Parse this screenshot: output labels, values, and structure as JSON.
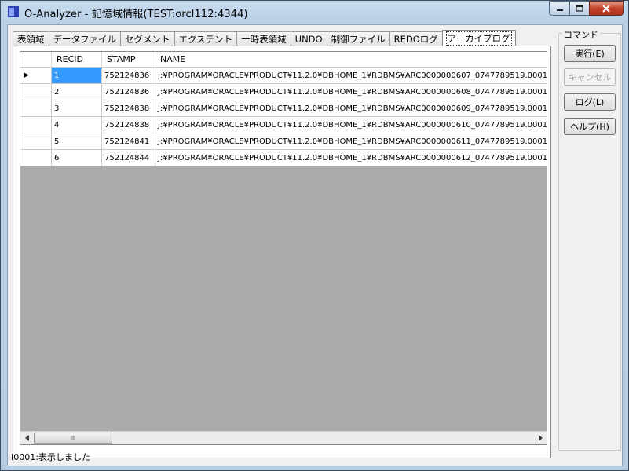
{
  "window": {
    "title": "O-Analyzer - 記憶域情報(TEST:orcl112:4344)"
  },
  "tabs": [
    {
      "label": "表領域"
    },
    {
      "label": "データファイル"
    },
    {
      "label": "セグメント"
    },
    {
      "label": "エクステント"
    },
    {
      "label": "一時表領域"
    },
    {
      "label": "UNDO"
    },
    {
      "label": "制御ファイル"
    },
    {
      "label": "REDOログ"
    },
    {
      "label": "アーカイブログ",
      "active": true
    }
  ],
  "grid": {
    "columns": [
      "RECID",
      "STAMP",
      "NAME"
    ],
    "rows": [
      {
        "recid": "1",
        "stamp": "752124836",
        "name": "J:¥PROGRAM¥ORACLE¥PRODUCT¥11.2.0¥DBHOME_1¥RDBMS¥ARC0000000607_0747789519.0001"
      },
      {
        "recid": "2",
        "stamp": "752124836",
        "name": "J:¥PROGRAM¥ORACLE¥PRODUCT¥11.2.0¥DBHOME_1¥RDBMS¥ARC0000000608_0747789519.0001"
      },
      {
        "recid": "3",
        "stamp": "752124838",
        "name": "J:¥PROGRAM¥ORACLE¥PRODUCT¥11.2.0¥DBHOME_1¥RDBMS¥ARC0000000609_0747789519.0001"
      },
      {
        "recid": "4",
        "stamp": "752124838",
        "name": "J:¥PROGRAM¥ORACLE¥PRODUCT¥11.2.0¥DBHOME_1¥RDBMS¥ARC0000000610_0747789519.0001"
      },
      {
        "recid": "5",
        "stamp": "752124841",
        "name": "J:¥PROGRAM¥ORACLE¥PRODUCT¥11.2.0¥DBHOME_1¥RDBMS¥ARC0000000611_0747789519.0001"
      },
      {
        "recid": "6",
        "stamp": "752124844",
        "name": "J:¥PROGRAM¥ORACLE¥PRODUCT¥11.2.0¥DBHOME_1¥RDBMS¥ARC0000000612_0747789519.0001"
      }
    ],
    "current_row_marker": "▶",
    "scroll_thumb_grip": "III"
  },
  "commands": {
    "group_label": "コマンド",
    "execute": "実行(E)",
    "cancel": "キャンセル",
    "log": "ログ(L)",
    "help": "ヘルプ(H)"
  },
  "status": {
    "text": "I0001:表示しました"
  },
  "colors": {
    "selection": "#3399ff",
    "grid_background": "#ababab",
    "close_button": "#c4432a"
  }
}
